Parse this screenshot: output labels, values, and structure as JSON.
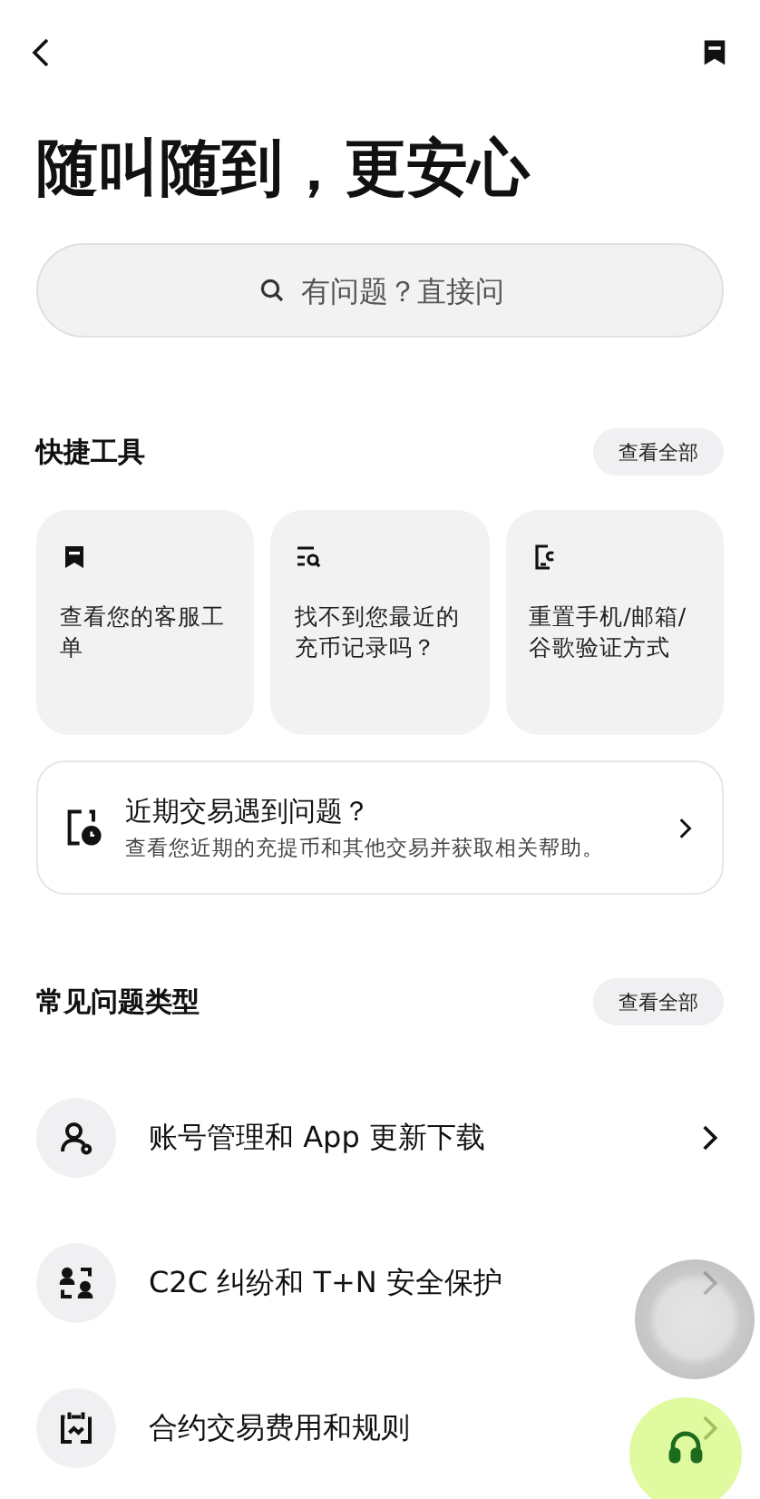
{
  "header": {
    "title": "随叫随到，更安心"
  },
  "search": {
    "placeholder": "有问题？直接问"
  },
  "quick_tools": {
    "title": "快捷工具",
    "view_all": "查看全部",
    "cards": [
      {
        "label": "查看您的客服工单"
      },
      {
        "label": "找不到您最近的充币记录吗？"
      },
      {
        "label": "重置手机/邮箱/谷歌验证方式"
      }
    ],
    "banner": {
      "title": "近期交易遇到问题？",
      "subtitle": "查看您近期的充提币和其他交易并获取相关帮助。"
    }
  },
  "faq": {
    "title": "常见问题类型",
    "view_all": "查看全部",
    "items": [
      {
        "label": "账号管理和 App 更新下载"
      },
      {
        "label": "C2C 纠纷和 T+N 安全保护"
      },
      {
        "label": "合约交易费用和规则"
      }
    ]
  }
}
